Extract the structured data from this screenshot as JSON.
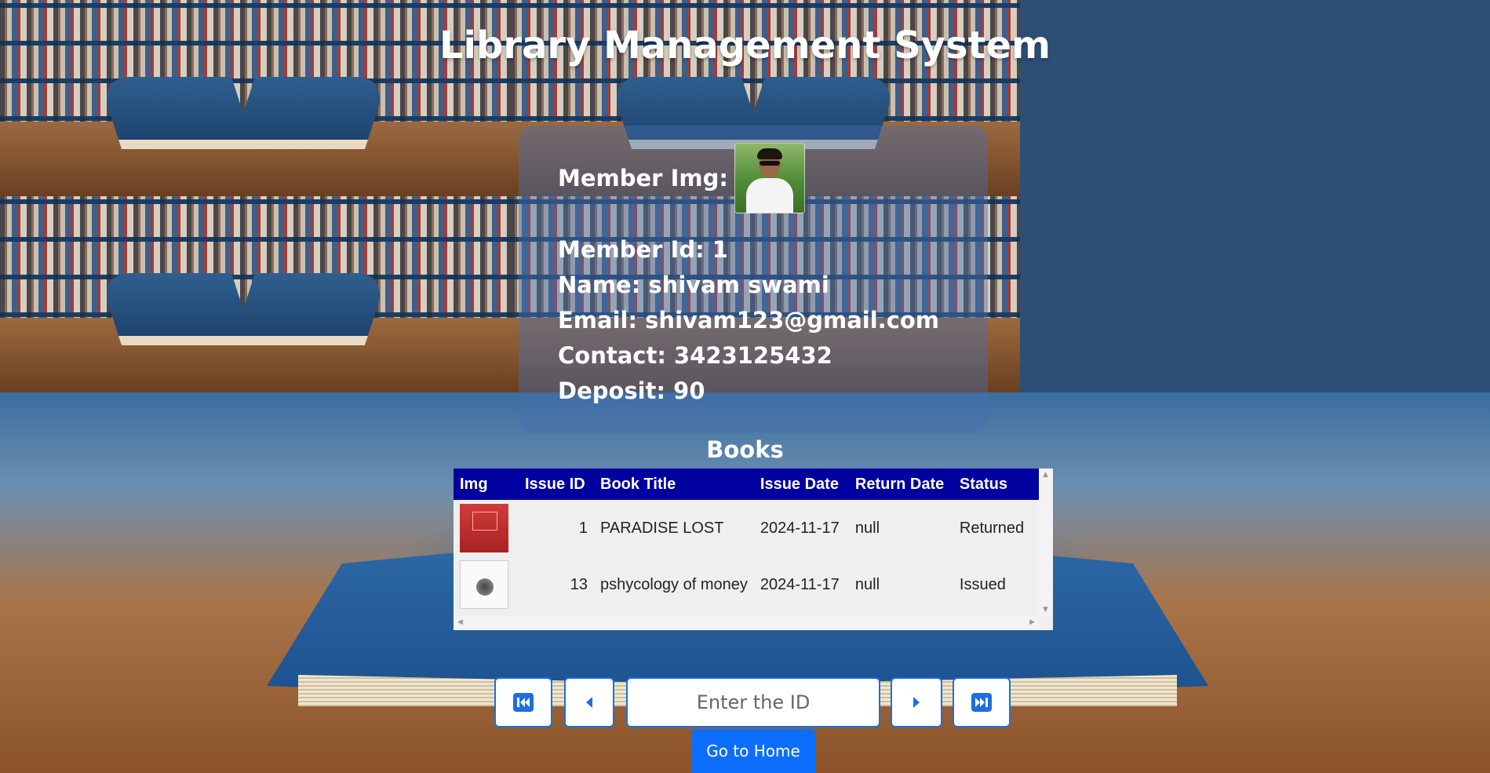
{
  "title": "Library Management System",
  "member": {
    "img_label": "Member Img:",
    "id": "Member Id: 1",
    "name": "Name: shivam swami",
    "email": "Email: shivam123@gmail.com",
    "contact": "Contact: 3423125432",
    "deposit": "Deposit: 90"
  },
  "books": {
    "heading": "Books",
    "columns": [
      "Img",
      "Issue ID",
      "Book Title",
      "Issue Date",
      "Return Date",
      "Status"
    ],
    "rows": [
      {
        "issue_id": "1",
        "title": "PARADISE LOST",
        "issue_date": "2024-11-17",
        "return_date": "null",
        "status": "Returned"
      },
      {
        "issue_id": "13",
        "title": "pshycology of money",
        "issue_date": "2024-11-17",
        "return_date": "null",
        "status": "Issued"
      }
    ]
  },
  "pager": {
    "id_placeholder": "Enter the ID"
  },
  "home_button": "Go to Home",
  "colors": {
    "table_header": "#00009e",
    "accent": "#0d6efd",
    "pager_border": "#1b6fe0"
  }
}
